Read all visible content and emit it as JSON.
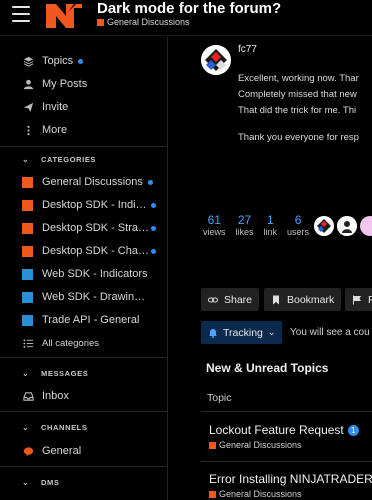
{
  "header": {
    "title": "Dark mode for the forum?",
    "category": "General Discussions",
    "category_color": "#f0581f"
  },
  "sidebar": {
    "top_items": [
      {
        "label": "Topics",
        "icon": "stack-icon",
        "unread": true
      },
      {
        "label": "My Posts",
        "icon": "user-icon"
      },
      {
        "label": "Invite",
        "icon": "paper-plane-icon"
      },
      {
        "label": "More",
        "icon": "more-dots-icon"
      }
    ],
    "categories_heading": "CATEGORIES",
    "categories": [
      {
        "label": "General Discussions",
        "color": "#f0581f",
        "unread": true
      },
      {
        "label": "Desktop SDK - Indic...",
        "color": "#f0581f",
        "unread": true
      },
      {
        "label": "Desktop SDK - Strat...",
        "color": "#f0581f",
        "unread": true
      },
      {
        "label": "Desktop SDK - Char...",
        "color": "#f0581f",
        "unread": true
      },
      {
        "label": "Web SDK - Indicators",
        "color": "#2a8fd4"
      },
      {
        "label": "Web SDK - Drawing To...",
        "color": "#2a8fd4"
      },
      {
        "label": "Trade API - General",
        "color": "#2a8fd4"
      }
    ],
    "all_categories": "All categories",
    "messages_heading": "MESSAGES",
    "inbox": "Inbox",
    "channels_heading": "CHANNELS",
    "general": "General",
    "dms_heading": "DMS"
  },
  "post": {
    "username": "fc77",
    "lines": [
      "Excellent, working now. Thar",
      "Completely missed that new",
      "That did the trick for me. Thi",
      "Thank you everyone for resp"
    ]
  },
  "stats": [
    {
      "value": "61",
      "label": "views"
    },
    {
      "value": "27",
      "label": "likes"
    },
    {
      "value": "1",
      "label": "link"
    },
    {
      "value": "6",
      "label": "users"
    }
  ],
  "buttons": {
    "share": "Share",
    "bookmark": "Bookmark",
    "flag": "F"
  },
  "tracking": {
    "label": "Tracking",
    "note": "You will see a cou"
  },
  "new_unread": {
    "title": "New & Unread Topics",
    "column": "Topic",
    "topics": [
      {
        "title": "Lockout Feature Request",
        "badge": "1",
        "category": "General Discussions"
      },
      {
        "title": "Error Installing NINJATRADER",
        "category": "General Discussions"
      }
    ]
  },
  "colors": {
    "accent_blue": "#2f8ef0",
    "brand_orange": "#f0581f",
    "tracking_bg": "#0c2a4d"
  }
}
